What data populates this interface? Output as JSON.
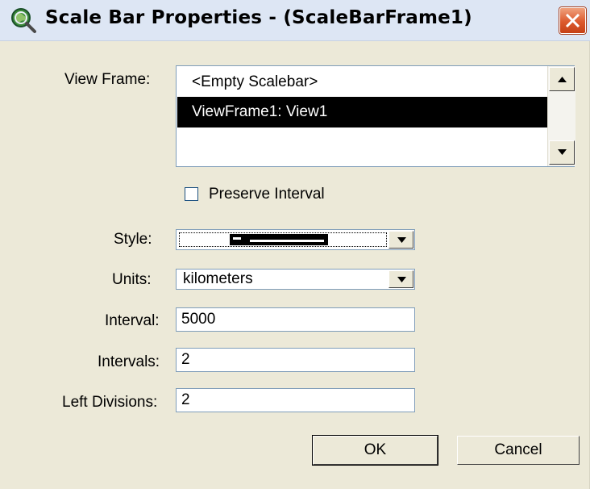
{
  "window": {
    "title": "Scale Bar Properties - (ScaleBarFrame1)"
  },
  "view_frame": {
    "label": "View Frame:",
    "items": [
      "<Empty Scalebar>",
      "ViewFrame1: View1"
    ],
    "selected_index": 1
  },
  "preserve_interval": {
    "label": "Preserve Interval",
    "checked": false
  },
  "style": {
    "label": "Style:"
  },
  "units": {
    "label": "Units:",
    "value": "kilometers"
  },
  "interval": {
    "label": "Interval:",
    "value": "5000"
  },
  "intervals": {
    "label": "Intervals:",
    "value": "2"
  },
  "left_divisions": {
    "label": "Left Divisions:",
    "value": "2"
  },
  "buttons": {
    "ok": "OK",
    "cancel": "Cancel"
  },
  "icons": {
    "app": "globe-magnifier-icon",
    "close": "close-icon",
    "scroll_up": "up-arrow-icon",
    "scroll_down": "down-arrow-icon",
    "dropdown": "down-arrow-icon"
  },
  "colors": {
    "close_button": "#dc5a2e",
    "selection": "#000000",
    "dialog_bg": "#ece9d8"
  }
}
